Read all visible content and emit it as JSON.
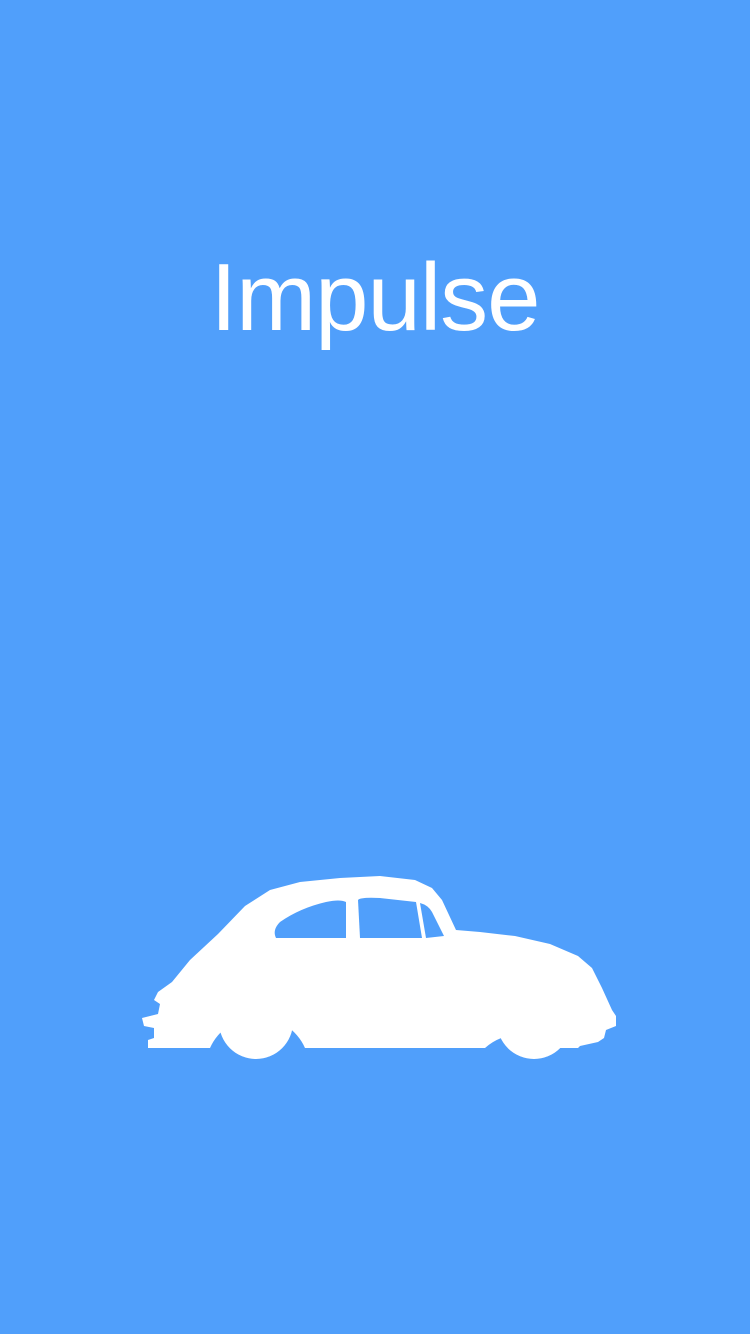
{
  "app": {
    "title": "Impulse"
  },
  "illustration": {
    "icon": "car-icon"
  },
  "colors": {
    "background": "#509ffb",
    "foreground": "#ffffff"
  }
}
